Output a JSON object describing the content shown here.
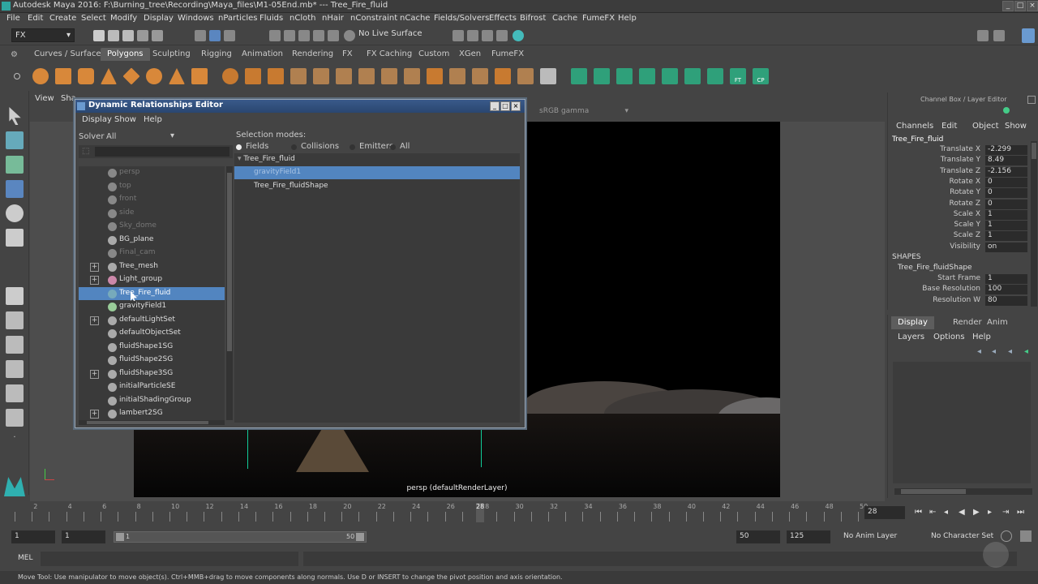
{
  "window": {
    "title": "Autodesk Maya 2016: F:\\Burning_tree\\Recording\\Maya_files\\M1-05End.mb* --- Tree_Fire_fluid"
  },
  "menubar": [
    "File",
    "Edit",
    "Create",
    "Select",
    "Modify",
    "Display",
    "Windows",
    "nParticles",
    "Fluids",
    "nCloth",
    "nHair",
    "nConstraint",
    "nCache",
    "Fields/Solvers",
    "Effects",
    "Bifrost",
    "Cache",
    "FumeFX",
    "Help"
  ],
  "statusline": {
    "mode": "FX",
    "live_surface": "No Live Surface"
  },
  "shelf_tabs": [
    "Curves / Surfaces",
    "Polygons",
    "Sculpting",
    "Rigging",
    "Animation",
    "Rendering",
    "FX",
    "FX Caching",
    "Custom",
    "XGen",
    "FumeFX"
  ],
  "shelf_active": "Polygons",
  "shelf_text_icons": {
    "ft": "FT",
    "cp": "CP"
  },
  "viewport": {
    "menu": [
      "View",
      "Sha"
    ],
    "color_space": "sRGB gamma",
    "camera_label": "persp (defaultRenderLayer)"
  },
  "dre": {
    "title": "Dynamic Relationships Editor",
    "menu": [
      "Display",
      "Show",
      "Help"
    ],
    "solver_label": "Solver",
    "solver_value": "All",
    "outliner": [
      {
        "label": "persp",
        "dim": true,
        "plus": false,
        "icon": "camera-icon",
        "color": "#888"
      },
      {
        "label": "top",
        "dim": true,
        "plus": false,
        "icon": "camera-icon",
        "color": "#888"
      },
      {
        "label": "front",
        "dim": true,
        "plus": false,
        "icon": "camera-icon",
        "color": "#888"
      },
      {
        "label": "side",
        "dim": true,
        "plus": false,
        "icon": "camera-icon",
        "color": "#888"
      },
      {
        "label": "Sky_dome",
        "dim": true,
        "plus": false,
        "icon": "mesh-icon",
        "color": "#888"
      },
      {
        "label": "BG_plane",
        "dim": false,
        "plus": false,
        "icon": "mesh-icon",
        "color": "#aaa"
      },
      {
        "label": "Final_cam",
        "dim": true,
        "plus": false,
        "icon": "camera-icon",
        "color": "#888"
      },
      {
        "label": "Tree_mesh",
        "dim": false,
        "plus": true,
        "icon": "mesh-icon",
        "color": "#aaa"
      },
      {
        "label": "Light_group",
        "dim": false,
        "plus": true,
        "icon": "group-icon",
        "color": "#c8a"
      },
      {
        "label": "Tree_Fire_fluid",
        "dim": false,
        "plus": false,
        "icon": "fluid-icon",
        "color": "#7ab",
        "selected": true
      },
      {
        "label": "gravityField1",
        "dim": false,
        "plus": false,
        "icon": "field-icon",
        "color": "#9c9"
      },
      {
        "label": "defaultLightSet",
        "dim": false,
        "plus": true,
        "icon": "set-icon",
        "color": "#aaa"
      },
      {
        "label": "defaultObjectSet",
        "dim": false,
        "plus": false,
        "icon": "set-icon",
        "color": "#aaa"
      },
      {
        "label": "fluidShape1SG",
        "dim": false,
        "plus": false,
        "icon": "shading-group-icon",
        "color": "#aaa"
      },
      {
        "label": "fluidShape2SG",
        "dim": false,
        "plus": false,
        "icon": "shading-group-icon",
        "color": "#aaa"
      },
      {
        "label": "fluidShape3SG",
        "dim": false,
        "plus": true,
        "icon": "shading-group-icon",
        "color": "#aaa"
      },
      {
        "label": "initialParticleSE",
        "dim": false,
        "plus": false,
        "icon": "shading-group-icon",
        "color": "#aaa"
      },
      {
        "label": "initialShadingGroup",
        "dim": false,
        "plus": false,
        "icon": "shading-group-icon",
        "color": "#aaa"
      },
      {
        "label": "lambert2SG",
        "dim": false,
        "plus": true,
        "icon": "shading-group-icon",
        "color": "#aaa"
      }
    ],
    "selection_modes_label": "Selection modes:",
    "modes": [
      {
        "label": "Fields",
        "on": true
      },
      {
        "label": "Collisions",
        "on": false
      },
      {
        "label": "Emitters",
        "on": false
      },
      {
        "label": "All",
        "on": false
      }
    ],
    "right_list": {
      "parent": "Tree_Fire_fluid",
      "items": [
        {
          "label": "gravityField1",
          "selected": true
        },
        {
          "label": "Tree_Fire_fluidShape",
          "selected": false
        }
      ]
    }
  },
  "channelbox": {
    "header": "Channel Box / Layer Editor",
    "menu": [
      "Channels",
      "Edit",
      "Object",
      "Show"
    ],
    "object": "Tree_Fire_fluid",
    "attrs": [
      {
        "label": "Translate X",
        "value": "-2.299"
      },
      {
        "label": "Translate Y",
        "value": "8.49"
      },
      {
        "label": "Translate Z",
        "value": "-2.156"
      },
      {
        "label": "Rotate X",
        "value": "0"
      },
      {
        "label": "Rotate Y",
        "value": "0"
      },
      {
        "label": "Rotate Z",
        "value": "0"
      },
      {
        "label": "Scale X",
        "value": "1"
      },
      {
        "label": "Scale Y",
        "value": "1"
      },
      {
        "label": "Scale Z",
        "value": "1"
      },
      {
        "label": "Visibility",
        "value": "on"
      }
    ],
    "shapes_label": "SHAPES",
    "shape_name": "Tree_Fire_fluidShape",
    "shape_attrs": [
      {
        "label": "Start Frame",
        "value": "1"
      },
      {
        "label": "Base Resolution",
        "value": "100"
      },
      {
        "label": "Resolution W",
        "value": "80"
      }
    ]
  },
  "layereditor": {
    "tabs": [
      "Display",
      "Render",
      "Anim"
    ],
    "active_tab": "Display",
    "menu": [
      "Layers",
      "Options",
      "Help"
    ]
  },
  "timeline": {
    "ticks": [
      1,
      2,
      3,
      4,
      5,
      6,
      7,
      8,
      9,
      10,
      11,
      12,
      13,
      14,
      15,
      16,
      17,
      18,
      19,
      20,
      21,
      22,
      23,
      24,
      25,
      26,
      27,
      28,
      29,
      30,
      31,
      32,
      33,
      34,
      35,
      36,
      37,
      38,
      39,
      40,
      41,
      42,
      43,
      44,
      45,
      46,
      47,
      48,
      49,
      50
    ],
    "labeled": [
      2,
      4,
      6,
      8,
      10,
      12,
      14,
      16,
      18,
      20,
      22,
      24,
      26,
      28,
      30,
      32,
      34,
      36,
      38,
      40,
      42,
      44,
      46,
      48,
      50
    ],
    "start": 1,
    "end": 50,
    "current": "28",
    "current_field": "28"
  },
  "range": {
    "start": "1",
    "playback_start": "1",
    "range_start_label": "1",
    "range_end_label": "50",
    "playback_end": "50",
    "end": "125",
    "anim_layer": "No Anim Layer",
    "char_set": "No Character Set"
  },
  "cmdline": {
    "label": "MEL"
  },
  "helpline": "Move Tool: Use manipulator to move object(s). Ctrl+MMB+drag to move components along normals. Use D or INSERT to change the pivot position and axis orientation."
}
